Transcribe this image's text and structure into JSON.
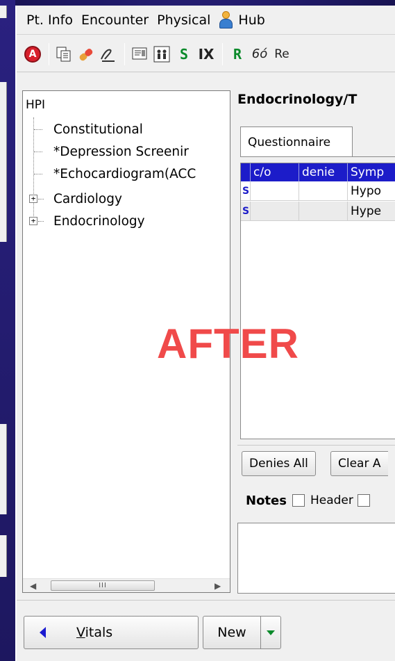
{
  "menu": {
    "items": [
      {
        "label": "Pt. Info"
      },
      {
        "label": "Encounter"
      },
      {
        "label": "Physical"
      },
      {
        "label": "Hub",
        "icon": "person-icon"
      }
    ]
  },
  "toolbar": {
    "s_label": "S",
    "ix_label": "IX",
    "r_label": "R",
    "glasses_label": "6ó",
    "re_label": "Re"
  },
  "tree": {
    "root": "HPI",
    "items": [
      {
        "label": "Constitutional"
      },
      {
        "label": "*Depression Screenir"
      },
      {
        "label": "*Echocardiogram(ACC"
      },
      {
        "label": "Cardiology",
        "expander": "+"
      },
      {
        "label": "Endocrinology",
        "expander": "+"
      }
    ],
    "scroll_thumb": "III"
  },
  "main": {
    "title": "Endocrinology/T",
    "tab": "Questionnaire",
    "grid": {
      "headers": [
        "",
        "c/o",
        "denie",
        "Symp"
      ],
      "rows": [
        {
          "s": "S",
          "co": "",
          "denies": "",
          "symptom": "Hypo"
        },
        {
          "s": "S",
          "co": "",
          "denies": "",
          "symptom": "Hype"
        }
      ]
    },
    "buttons": {
      "denies_all": "Denies All",
      "clear_all": "Clear A"
    },
    "notes": {
      "label": "Notes",
      "header_checkbox": "Header"
    }
  },
  "bottom": {
    "vitals": "Vitals",
    "vitals_underline": "V",
    "vitals_rest": "itals",
    "new": "New"
  },
  "overlay_text": "AFTER",
  "colors": {
    "background": "#201a6a",
    "grid_header": "#1c1cc9",
    "overlay": "#f04a4a",
    "green": "#0a8a2a"
  }
}
